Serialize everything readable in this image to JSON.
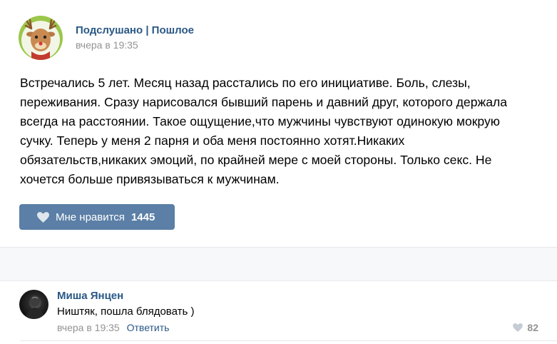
{
  "post": {
    "author": "Подслушано | Пошлое",
    "time": "вчера в 19:35",
    "text_lines": [
      "Встречались 5 лет. Месяц назад расстались по его инициативе. Боль, слезы,",
      "переживания. Сразу нарисовался бывший парень и давний друг, которого держала",
      "всегда на расстоянии. Такое ощущение,что мужчины чувствуют одинокую мокрую",
      "сучку. Теперь у меня 2 парня и оба меня постоянно хотят.Никаких",
      "обязательств,никаких эмоций, по крайней мере с моей стороны. Только секс. Не",
      "хочется больше привязываться к мужчинам."
    ],
    "like_label": "Мне нравится",
    "like_count": "1445"
  },
  "comment": {
    "author": "Миша Янцен",
    "text": "Ништяк, пошла блядовать )",
    "time": "вчера в 19:35",
    "reply_label": "Ответить",
    "likes": "82"
  },
  "icons": {
    "avatar": "deer-avatar-icon",
    "like": "heart-icon",
    "comment_like": "heart-icon"
  },
  "colors": {
    "link": "#2a5885",
    "like_button": "#5b7fa6",
    "muted": "#939393"
  }
}
